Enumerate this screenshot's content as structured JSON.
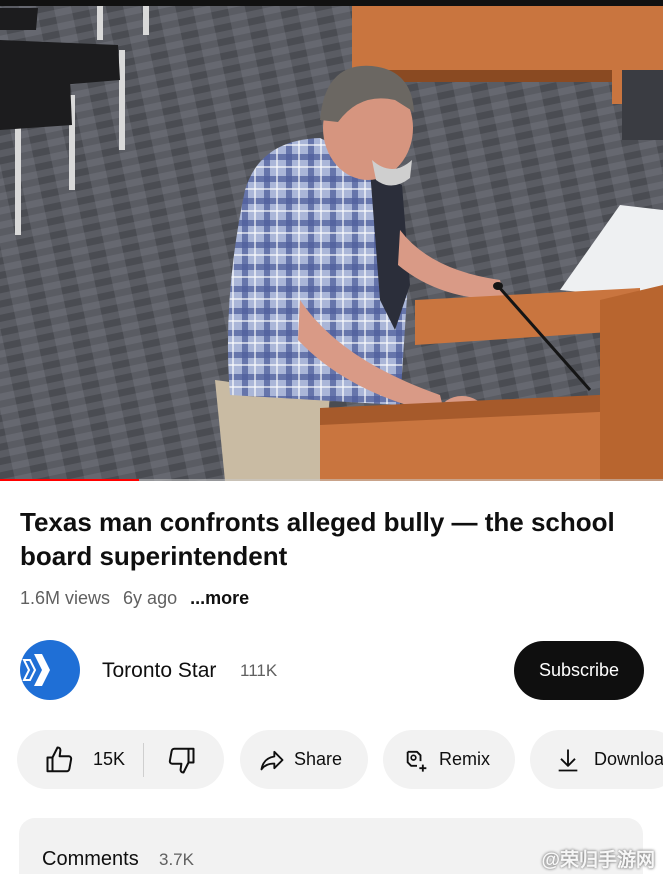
{
  "video": {
    "progress_fraction": 0.21,
    "colors": {
      "progress": "#ff0000",
      "track": "#c8c8c8"
    }
  },
  "title": "Texas man confronts alleged bully — the school board superintendent",
  "meta": {
    "views": "1.6M views",
    "age": "6y ago",
    "more": "...more"
  },
  "channel": {
    "name": "Toronto Star",
    "subscribers": "111K",
    "avatar_color": "#1f6fd6",
    "subscribe_label": "Subscribe"
  },
  "actions": {
    "likes": "15K",
    "share": "Share",
    "remix": "Remix",
    "download": "Downloa"
  },
  "icons": [
    "thumbs-up-icon",
    "thumbs-down-icon",
    "share-icon",
    "remix-icon",
    "download-icon"
  ],
  "comments": {
    "label": "Comments",
    "count": "3.7K"
  },
  "watermark": "@荣归手游网"
}
